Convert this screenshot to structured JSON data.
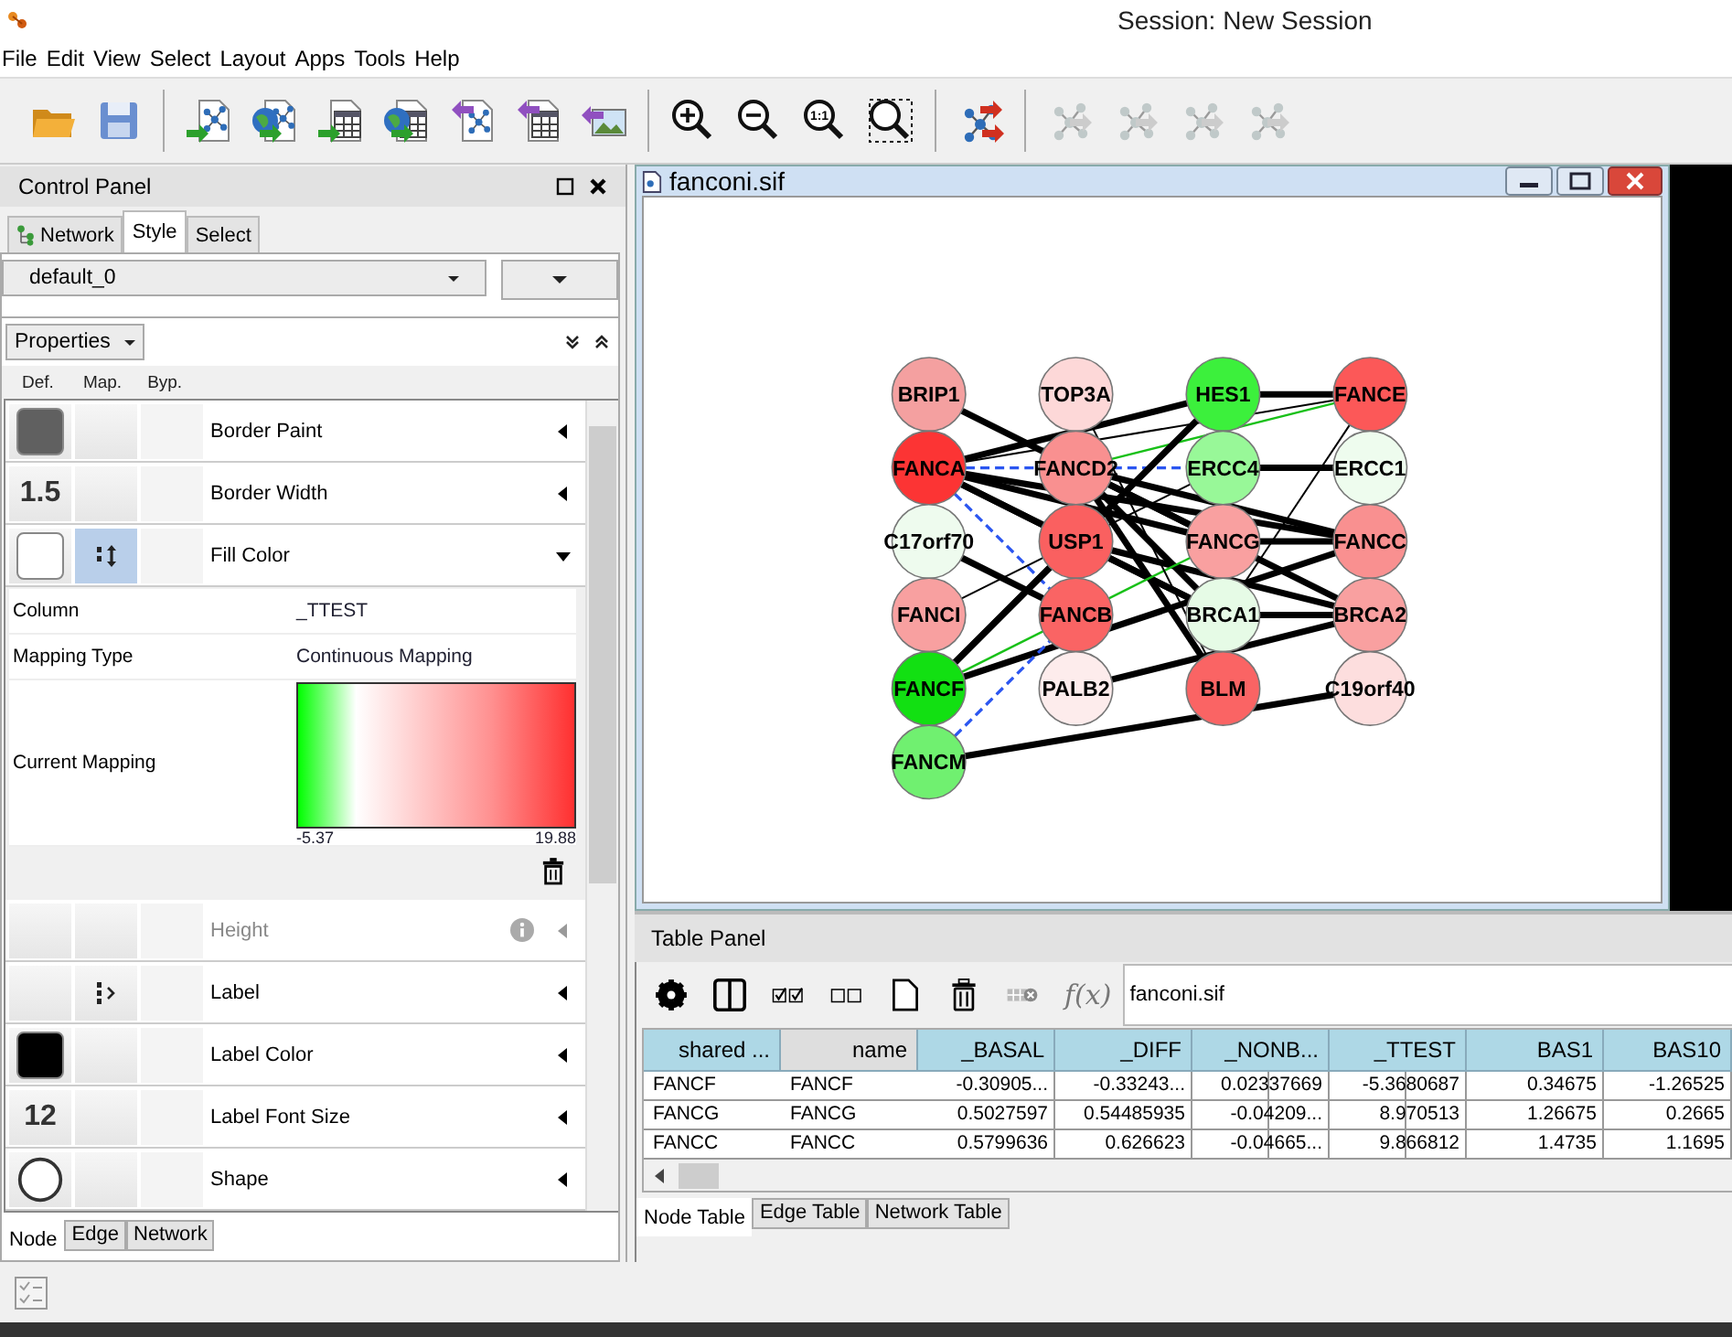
{
  "window": {
    "title": "Session: New Session"
  },
  "menu": [
    "File",
    "Edit",
    "View",
    "Select",
    "Layout",
    "Apps",
    "Tools",
    "Help"
  ],
  "toolbar": [
    [
      {
        "kind": "open",
        "disabled": false
      },
      {
        "kind": "save",
        "disabled": false
      }
    ],
    [
      {
        "kind": "import-network",
        "disabled": false
      },
      {
        "kind": "import-network-web",
        "disabled": false
      },
      {
        "kind": "import-table",
        "disabled": false
      },
      {
        "kind": "import-table-web",
        "disabled": false
      },
      {
        "kind": "export-network",
        "disabled": false
      },
      {
        "kind": "export-table",
        "disabled": false
      },
      {
        "kind": "export-image",
        "disabled": false
      }
    ],
    [
      {
        "kind": "zoom-in",
        "disabled": false
      },
      {
        "kind": "zoom-out",
        "disabled": false
      },
      {
        "kind": "zoom-actual",
        "disabled": false,
        "label": "1:1"
      },
      {
        "kind": "zoom-selected",
        "disabled": false
      }
    ],
    [
      {
        "kind": "layout",
        "disabled": false
      }
    ],
    [
      {
        "kind": "network-a",
        "disabled": true
      },
      {
        "kind": "network-b",
        "disabled": true
      },
      {
        "kind": "network-c",
        "disabled": true
      },
      {
        "kind": "network-d",
        "disabled": true
      }
    ]
  ],
  "control_panel": {
    "title": "Control Panel",
    "tabs": [
      {
        "label": "Network",
        "selected": false
      },
      {
        "label": "Style",
        "selected": true
      },
      {
        "label": "Select",
        "selected": false
      }
    ],
    "style_name": "default_0",
    "properties_button": "Properties",
    "column_headers": [
      "Def.",
      "Map.",
      "Byp."
    ],
    "properties": [
      {
        "label": "Border Paint",
        "kind": "swatch",
        "color": "#606060",
        "expanded": false,
        "disabled": false
      },
      {
        "label": "Border Width",
        "kind": "number",
        "value": "1.5",
        "expanded": false,
        "disabled": false
      },
      {
        "label": "Fill Color",
        "kind": "swatch",
        "color": "#ffffff",
        "mapping": {
          "kind": "continuous"
        },
        "expanded": true,
        "disabled": false,
        "details": {
          "column_label": "Column",
          "column": "_TTEST",
          "type_label": "Mapping Type",
          "type": "Continuous Mapping",
          "current_label": "Current Mapping",
          "min": "-5.37",
          "max": "19.88"
        }
      },
      {
        "label": "Height",
        "kind": "empty",
        "expanded": false,
        "disabled": true
      },
      {
        "label": "Label",
        "kind": "empty",
        "mapping": {
          "kind": "passthrough"
        },
        "expanded": false,
        "disabled": false
      },
      {
        "label": "Label Color",
        "kind": "swatch",
        "color": "#000000",
        "expanded": false,
        "disabled": false
      },
      {
        "label": "Label Font Size",
        "kind": "number",
        "value": "12",
        "expanded": false,
        "disabled": false
      },
      {
        "label": "Shape",
        "kind": "circle",
        "expanded": false,
        "disabled": false
      }
    ],
    "bottom_tabs": [
      {
        "label": "Node",
        "selected": true
      },
      {
        "label": "Edge",
        "selected": false
      },
      {
        "label": "Network",
        "selected": false
      }
    ]
  },
  "network_view": {
    "title": "fanconi.sif",
    "node_columns": [
      [
        {
          "label": "BRIP1",
          "color": "#f4a0a0"
        },
        {
          "label": "FANCA",
          "color": "#fc3434"
        },
        {
          "label": "C17orf70",
          "color": "#eefbee"
        },
        {
          "label": "FANCI",
          "color": "#f8a0a0"
        },
        {
          "label": "FANCF",
          "color": "#12e012"
        },
        {
          "label": "FANCM",
          "color": "#70f070"
        }
      ],
      [
        {
          "label": "TOP3A",
          "color": "#fdd8d8"
        },
        {
          "label": "FANCD2",
          "color": "#f99090"
        },
        {
          "label": "USP1",
          "color": "#fa6060"
        },
        {
          "label": "FANCB",
          "color": "#fa6464"
        },
        {
          "label": "PALB2",
          "color": "#fdecec"
        }
      ],
      [
        {
          "label": "HES1",
          "color": "#3cf03c"
        },
        {
          "label": "ERCC4",
          "color": "#98f898"
        },
        {
          "label": "FANCG",
          "color": "#f9a0a0"
        },
        {
          "label": "BRCA1",
          "color": "#e6fbe6"
        },
        {
          "label": "BLM",
          "color": "#fa6464"
        }
      ],
      [
        {
          "label": "FANCE",
          "color": "#fc5858"
        },
        {
          "label": "ERCC1",
          "color": "#eefcee"
        },
        {
          "label": "FANCC",
          "color": "#f99090"
        },
        {
          "label": "BRCA2",
          "color": "#f9a0a0"
        },
        {
          "label": "C19orf40",
          "color": "#fddede"
        }
      ]
    ]
  },
  "table_panel": {
    "title": "Table Panel",
    "network_field": "fanconi.sif",
    "function_button": "f(x)",
    "columns": [
      {
        "label": "shared ...",
        "selected": true
      },
      {
        "label": "name",
        "selected": false
      },
      {
        "label": "_BASAL",
        "selected": true
      },
      {
        "label": "_DIFF",
        "selected": true
      },
      {
        "label": "_NONB...",
        "selected": true
      },
      {
        "label": "_TTEST",
        "selected": true
      },
      {
        "label": "BAS1",
        "selected": true
      },
      {
        "label": "BAS10",
        "selected": true
      }
    ],
    "rows": [
      [
        "FANCF",
        "FANCF",
        "-0.30905...",
        "-0.33243...",
        "0.02337669",
        "-5.3680687",
        "0.34675",
        "-1.26525"
      ],
      [
        "FANCG",
        "FANCG",
        "0.5027597",
        "0.54485935",
        "-0.04209...",
        "8.970513",
        "1.26675",
        "0.2665"
      ],
      [
        "FANCC",
        "FANCC",
        "0.5799636",
        "0.626623",
        "-0.04665...",
        "9.866812",
        "1.4735",
        "1.1695"
      ]
    ],
    "tabs": [
      {
        "label": "Node Table",
        "selected": true
      },
      {
        "label": "Edge Table",
        "selected": false
      },
      {
        "label": "Network Table",
        "selected": false
      }
    ]
  }
}
